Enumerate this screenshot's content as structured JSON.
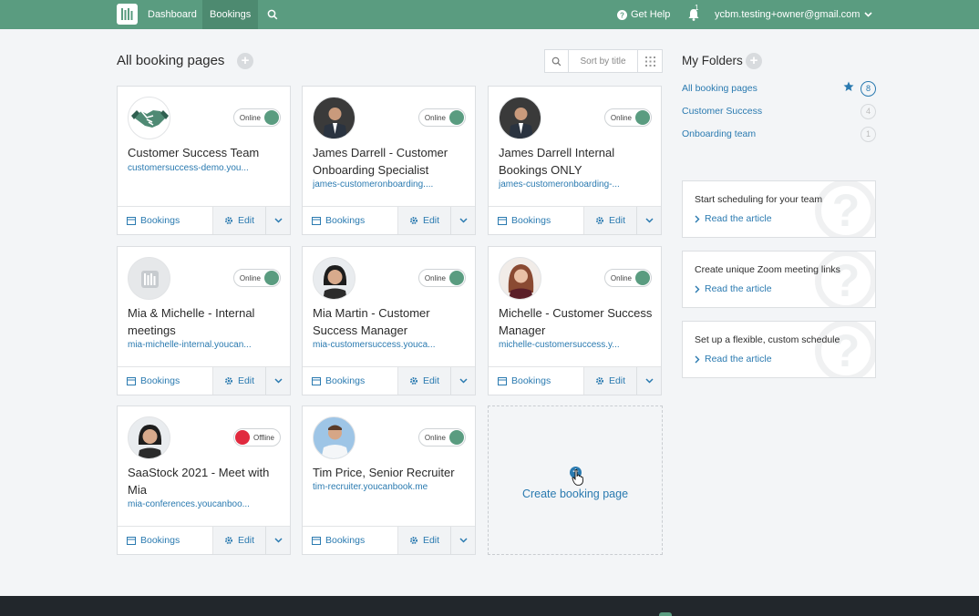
{
  "nav": {
    "dashboard": "Dashboard",
    "bookings": "Bookings",
    "get_help": "Get Help",
    "notifications_count": "1",
    "account_email": "ycbm.testing+owner@gmail.com"
  },
  "main": {
    "title": "All booking pages",
    "sort_label": "Sort by title"
  },
  "cards": [
    {
      "name": "Customer Success Team",
      "url": "customersuccess-demo.you...",
      "status": "Online",
      "bookings": "Bookings",
      "edit": "Edit"
    },
    {
      "name": "James Darrell - Customer Onboarding Specialist",
      "url": "james-customeronboarding....",
      "status": "Online",
      "bookings": "Bookings",
      "edit": "Edit"
    },
    {
      "name": "James Darrell Internal Bookings ONLY",
      "url": "james-customeronboarding-...",
      "status": "Online",
      "bookings": "Bookings",
      "edit": "Edit"
    },
    {
      "name": "Mia & Michelle - Internal meetings",
      "url": "mia-michelle-internal.youcan...",
      "status": "Online",
      "bookings": "Bookings",
      "edit": "Edit"
    },
    {
      "name": "Mia Martin - Customer Success Manager",
      "url": "mia-customersuccess.youca...",
      "status": "Online",
      "bookings": "Bookings",
      "edit": "Edit"
    },
    {
      "name": "Michelle - Customer Success Manager",
      "url": "michelle-customersuccess.y...",
      "status": "Online",
      "bookings": "Bookings",
      "edit": "Edit"
    },
    {
      "name": "SaaStock 2021 - Meet with Mia",
      "url": "mia-conferences.youcanboo...",
      "status": "Offline",
      "bookings": "Bookings",
      "edit": "Edit"
    },
    {
      "name": "Tim Price, Senior Recruiter",
      "url": "tim-recruiter.youcanbook.me",
      "status": "Online",
      "bookings": "Bookings",
      "edit": "Edit"
    }
  ],
  "create": {
    "label": "Create booking page"
  },
  "folders": {
    "title": "My Folders",
    "items": [
      {
        "label": "All booking pages",
        "count": "8"
      },
      {
        "label": "Customer Success",
        "count": "4"
      },
      {
        "label": "Onboarding team",
        "count": "1"
      }
    ]
  },
  "articles": [
    {
      "title": "Start scheduling for your team",
      "link": "Read the article"
    },
    {
      "title": "Create unique Zoom meeting links",
      "link": "Read the article"
    },
    {
      "title": "Set up a flexible, custom schedule",
      "link": "Read the article"
    }
  ],
  "colors": {
    "brand": "#5a9c80",
    "link": "#2a7ab0",
    "offline": "#e02a3e"
  }
}
